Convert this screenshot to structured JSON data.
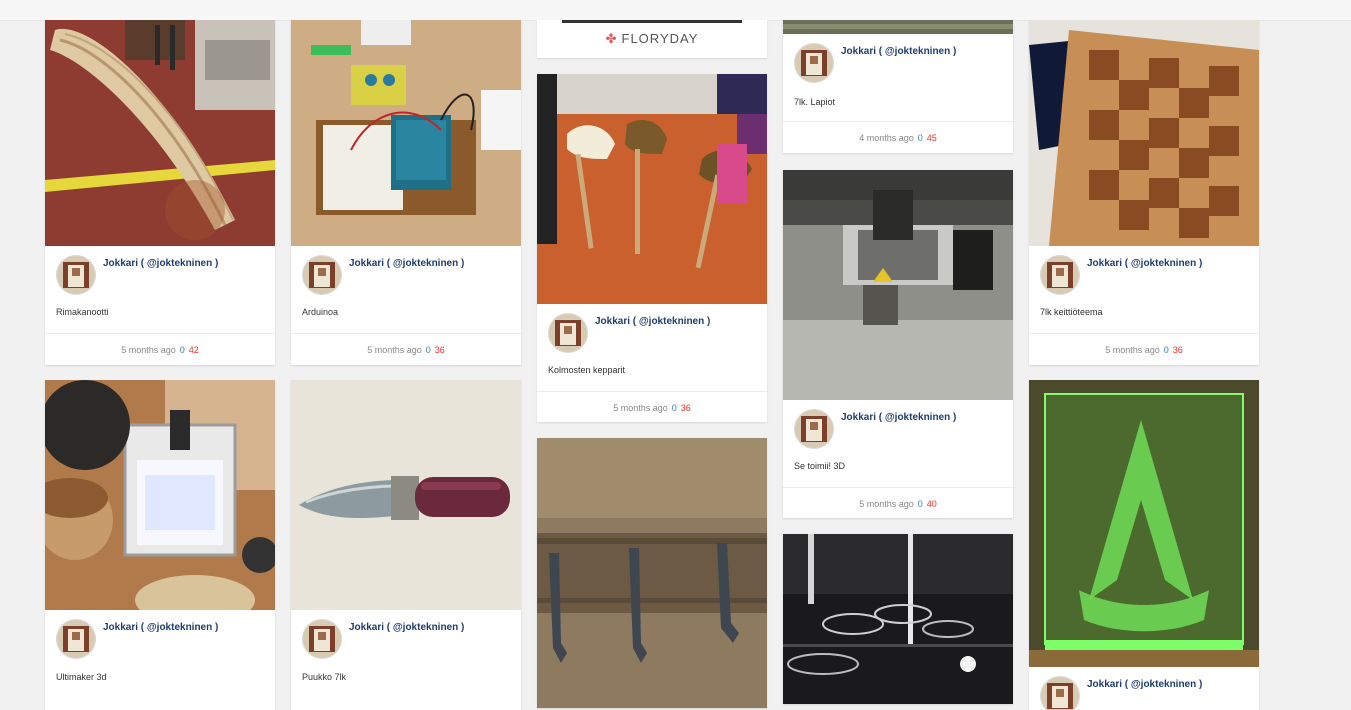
{
  "author_name": "Jokkari ( @joktekninen )",
  "ad": {
    "brand": "FLORYDAY",
    "icon": "flower-icon"
  },
  "colors": {
    "author": "#1e3e6e",
    "views": "#e8342c",
    "likes": "#3f7fb5"
  },
  "cards": {
    "rimakanootti": {
      "caption": "Rimakanootti",
      "time": "5 months ago",
      "likes": "0",
      "views": "42"
    },
    "arduinoa": {
      "caption": "Arduinoa",
      "time": "5 months ago",
      "likes": "0",
      "views": "36"
    },
    "kolmosten": {
      "caption": "Kolmosten kepparit",
      "time": "5 months ago",
      "likes": "0",
      "views": "36"
    },
    "lapiot": {
      "caption": "7lk. Lapiot",
      "time": "4 months ago",
      "likes": "0",
      "views": "45"
    },
    "keittio": {
      "caption": "7lk keittiöteema",
      "time": "5 months ago",
      "likes": "0",
      "views": "36"
    },
    "toimii": {
      "caption": "Se toimii! 3D",
      "time": "5 months ago",
      "likes": "0",
      "views": "40"
    },
    "ultimaker": {
      "caption": "Ultimaker 3d"
    },
    "puukko": {
      "caption": "Puukko 7lk"
    }
  }
}
